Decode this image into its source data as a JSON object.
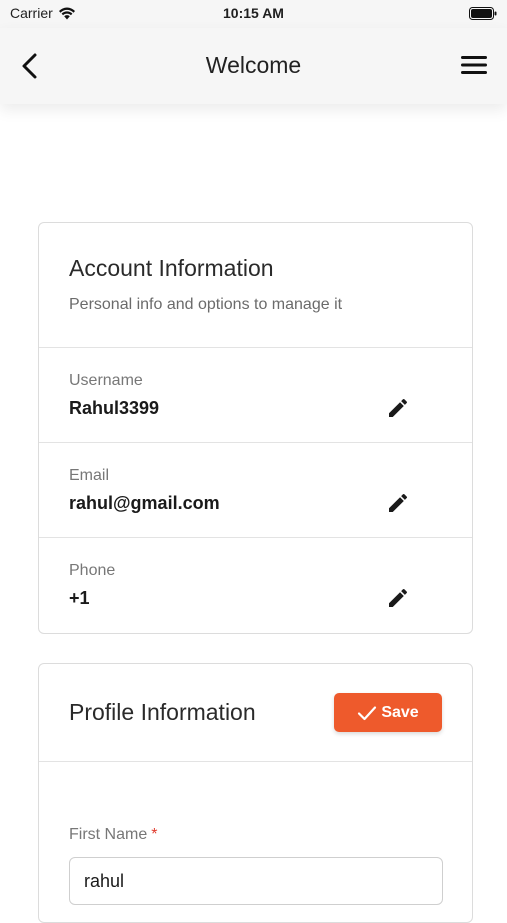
{
  "status_bar": {
    "carrier": "Carrier",
    "time": "10:15 AM"
  },
  "nav": {
    "title": "Welcome"
  },
  "account": {
    "title": "Account Information",
    "subtitle": "Personal info and options to manage it",
    "rows": [
      {
        "label": "Username",
        "value": "Rahul3399"
      },
      {
        "label": "Email",
        "value": "rahul@gmail.com"
      },
      {
        "label": "Phone",
        "value": "+1"
      }
    ]
  },
  "profile": {
    "title": "Profile Information",
    "save_label": "Save",
    "first_name_label": "First Name",
    "required_marker": "*",
    "first_name_value": "rahul"
  },
  "colors": {
    "accent": "#ee5a2c",
    "required": "#e0392b"
  }
}
